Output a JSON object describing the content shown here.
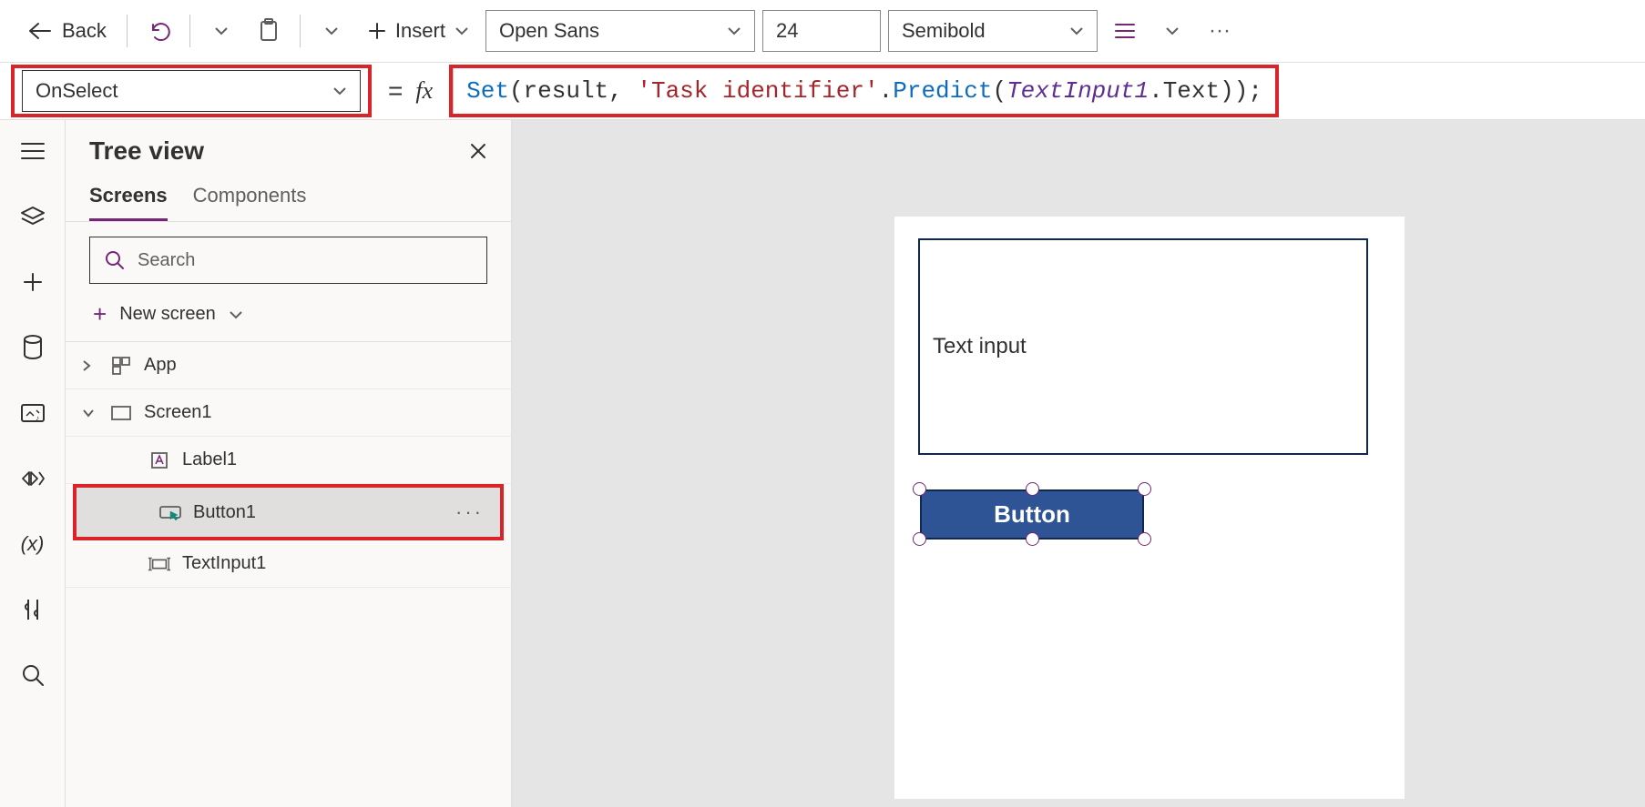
{
  "toolbar": {
    "back": "Back",
    "insert": "Insert",
    "font": "Open Sans",
    "fontSize": "24",
    "fontWeight": "Semibold"
  },
  "formula": {
    "property": "OnSelect",
    "tokens": {
      "set": "Set",
      "p1": "(result, ",
      "str": "'Task identifier'",
      "dot1": ".",
      "predict": "Predict",
      "p2": "(",
      "ref": "TextInput1",
      "dot2": ".",
      "text": "Text",
      "p3": "));"
    }
  },
  "tree": {
    "title": "Tree view",
    "tabs": {
      "screens": "Screens",
      "components": "Components"
    },
    "searchPlaceholder": "Search",
    "newScreen": "New screen",
    "items": {
      "app": "App",
      "screen1": "Screen1",
      "label1": "Label1",
      "button1": "Button1",
      "textinput1": "TextInput1"
    }
  },
  "canvas": {
    "textInputPlaceholder": "Text input",
    "buttonLabel": "Button"
  }
}
